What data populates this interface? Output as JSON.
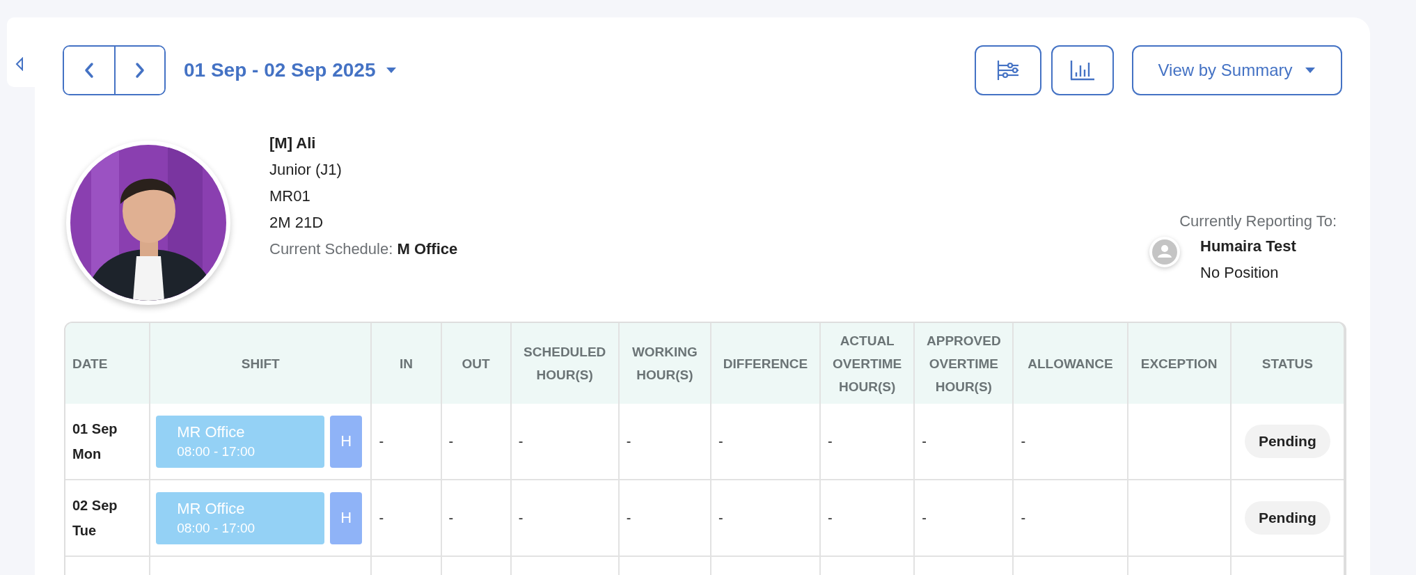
{
  "date_range": {
    "label": "01 Sep - 02 Sep 2025"
  },
  "view_selector": {
    "label": "View by Summary"
  },
  "employee": {
    "name": "[M] Ali",
    "position": "Junior (J1)",
    "code": "MR01",
    "tenure": "2M 21D",
    "schedule_label": "Current Schedule:",
    "schedule_value": "M Office"
  },
  "reporting": {
    "label": "Currently Reporting To:",
    "name": "Humaira Test",
    "position": "No Position"
  },
  "table": {
    "columns": [
      "DATE",
      "SHIFT",
      "IN",
      "OUT",
      "SCHEDULED HOUR(S)",
      "WORKING HOUR(S)",
      "DIFFERENCE",
      "ACTUAL OVERTIME HOUR(S)",
      "APPROVED OVERTIME HOUR(S)",
      "ALLOWANCE",
      "EXCEPTION",
      "STATUS"
    ],
    "rows": [
      {
        "date": "01 Sep",
        "day": "Mon",
        "shift_name": "MR Office",
        "shift_time": "08:00 - 17:00",
        "shift_tag": "H",
        "in": "-",
        "out": "-",
        "scheduled": "-",
        "working": "-",
        "difference": "-",
        "actual_ot": "-",
        "approved_ot": "-",
        "allowance": "-",
        "status": "Pending"
      },
      {
        "date": "02 Sep",
        "day": "Tue",
        "shift_name": "MR Office",
        "shift_time": "08:00 - 17:00",
        "shift_tag": "H",
        "in": "-",
        "out": "-",
        "scheduled": "-",
        "working": "-",
        "difference": "-",
        "actual_ot": "-",
        "approved_ot": "-",
        "allowance": "-",
        "status": "Pending"
      }
    ]
  }
}
